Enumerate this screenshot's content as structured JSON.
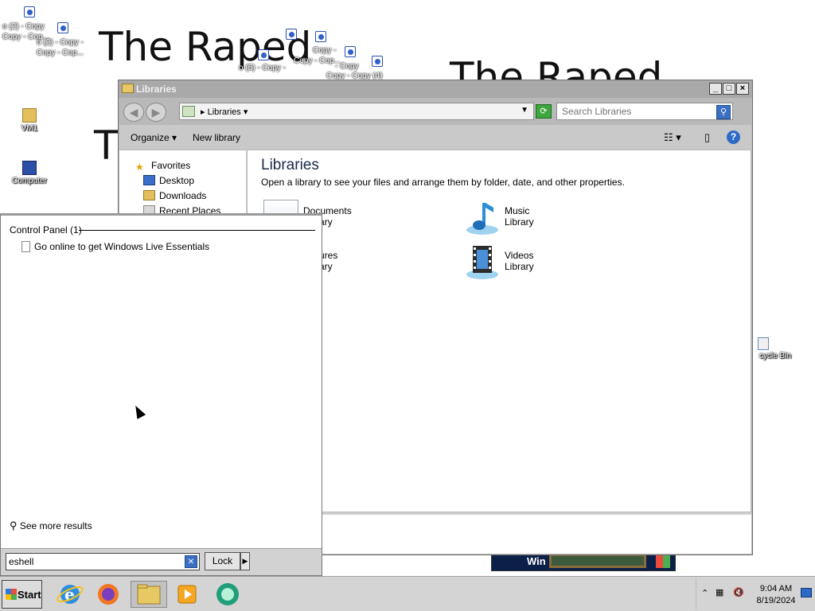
{
  "desktop": {
    "wallpaper_text_1": "The Raped",
    "wallpaper_text_2": "The Raped",
    "wallpaper_text_3": "T",
    "icons": [
      {
        "label": "VM1",
        "icon": "folder-icon"
      },
      {
        "label": "Computer",
        "icon": "computer-icon"
      },
      {
        "label": "cycle Bin",
        "icon": "recycle-bin-icon"
      }
    ],
    "shortcut_labels": [
      "o (2) - Copy",
      "Copy - Cop...",
      "o (2) - Copy -",
      "Copy - Cop...",
      "o (5) - Copy -",
      "Copy -",
      "Copy - Cop...",
      "- Copy",
      "Copy - Copy (4)"
    ]
  },
  "explorer": {
    "title": "Libraries",
    "breadcrumb": "Libraries",
    "search_placeholder": "Search Libraries",
    "toolbar": {
      "organize": "Organize",
      "new_library": "New library"
    },
    "nav": {
      "favorites": "Favorites",
      "desktop": "Desktop",
      "downloads": "Downloads",
      "recent_places": "Recent Places"
    },
    "heading": "Libraries",
    "description": "Open a library to see your files and arrange them by folder, date, and other properties.",
    "libraries": [
      {
        "name": "Documents",
        "sub": "Library"
      },
      {
        "name": "Music",
        "sub": "Library"
      },
      {
        "name": "Pictures",
        "sub": "Library"
      },
      {
        "name": "Videos",
        "sub": "Library"
      }
    ]
  },
  "start_menu": {
    "category": "Control Panel (1)",
    "result": "Go online to get Windows Live Essentials",
    "see_more": "See more results",
    "search_value": "eshell",
    "lock_label": "Lock"
  },
  "thumbnail": {
    "text": "Win"
  },
  "taskbar": {
    "start_label": "Start",
    "apps": [
      "internet-explorer-icon",
      "firefox-icon",
      "explorer-icon",
      "media-player-icon",
      "chat-icon"
    ],
    "time": "9:04 AM",
    "date": "8/19/2024"
  }
}
